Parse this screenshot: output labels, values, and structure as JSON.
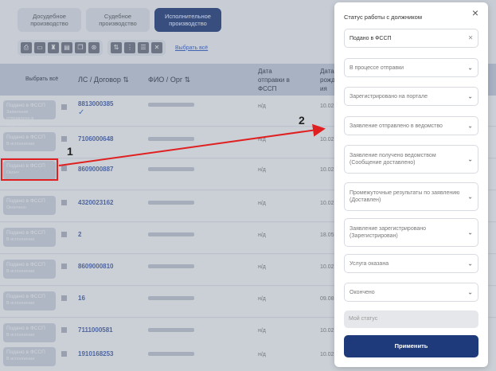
{
  "tabs": [
    {
      "label": "Досудебное производство"
    },
    {
      "label": "Судебное производство"
    },
    {
      "label": "Исполнительное производство"
    }
  ],
  "toolbar": {
    "select_all_link": "Выбрать всё"
  },
  "table": {
    "select_all": "Выбрать всё",
    "col_ls": "ЛС / Договор",
    "col_fio": "ФИО / Орг",
    "col_date_line1": "Дата",
    "col_date_line2": "отправки в",
    "col_date_line3": "ФССП",
    "col_date2_line1": "Дата",
    "col_date2_line2": "рожд",
    "col_date2_line3": "ия",
    "rows": [
      {
        "status": "Подано в ФССП",
        "sub": "Заявление отправлено в ведомство",
        "acc": "8813000385",
        "nd": "н/д",
        "dt": "10.02."
      },
      {
        "status": "Подано в ФССП",
        "sub": "В исполнении",
        "acc": "7106000648",
        "nd": "н/д",
        "dt": "10.02."
      },
      {
        "status": "Подано в ФССП",
        "sub": "Оконч",
        "acc": "8609000887",
        "nd": "н/д",
        "dt": "10.02."
      },
      {
        "status": "Подано в ФССП",
        "sub": "Окончено",
        "acc": "4320023162",
        "nd": "н/д",
        "dt": "10.02."
      },
      {
        "status": "Подано в ФССП",
        "sub": "В исполнении",
        "acc": "2",
        "nd": "н/д",
        "dt": "18.05."
      },
      {
        "status": "Подано в ФССП",
        "sub": "В исполнении",
        "acc": "8609000810",
        "nd": "н/д",
        "dt": "10.02."
      },
      {
        "status": "Подано в ФССП",
        "sub": "В исполнении",
        "acc": "16",
        "nd": "н/д",
        "dt": "09.08."
      },
      {
        "status": "Подано в ФССП",
        "sub": "В исполнении",
        "acc": "7111000581",
        "nd": "н/д",
        "dt": "10.02."
      },
      {
        "status": "Подано в ФССП",
        "sub": "В исполнении",
        "acc": "1910168253",
        "nd": "н/д",
        "dt": "10.02."
      }
    ]
  },
  "annotations": {
    "label1": "1",
    "label2": "2"
  },
  "panel": {
    "title": "Статус работы с должником",
    "selected": "Подано в ФССП",
    "options": [
      "В процессе отправки",
      "Зарегистрировано на портале",
      "Заявление отправлено в ведомство",
      "Заявление получено ведомством (Сообщение доставлено)",
      "Промежуточные результаты по заявлению (Доставлен)",
      "Заявление зарегистрировано (Зарегистрирован)",
      "Услуга оказана",
      "Окончено"
    ],
    "my_status_placeholder": "Мой статус",
    "apply_label": "Применить"
  },
  "colors": {
    "primary": "#1f3a7a",
    "link": "#3e5aa6",
    "highlight": "#e02020"
  }
}
